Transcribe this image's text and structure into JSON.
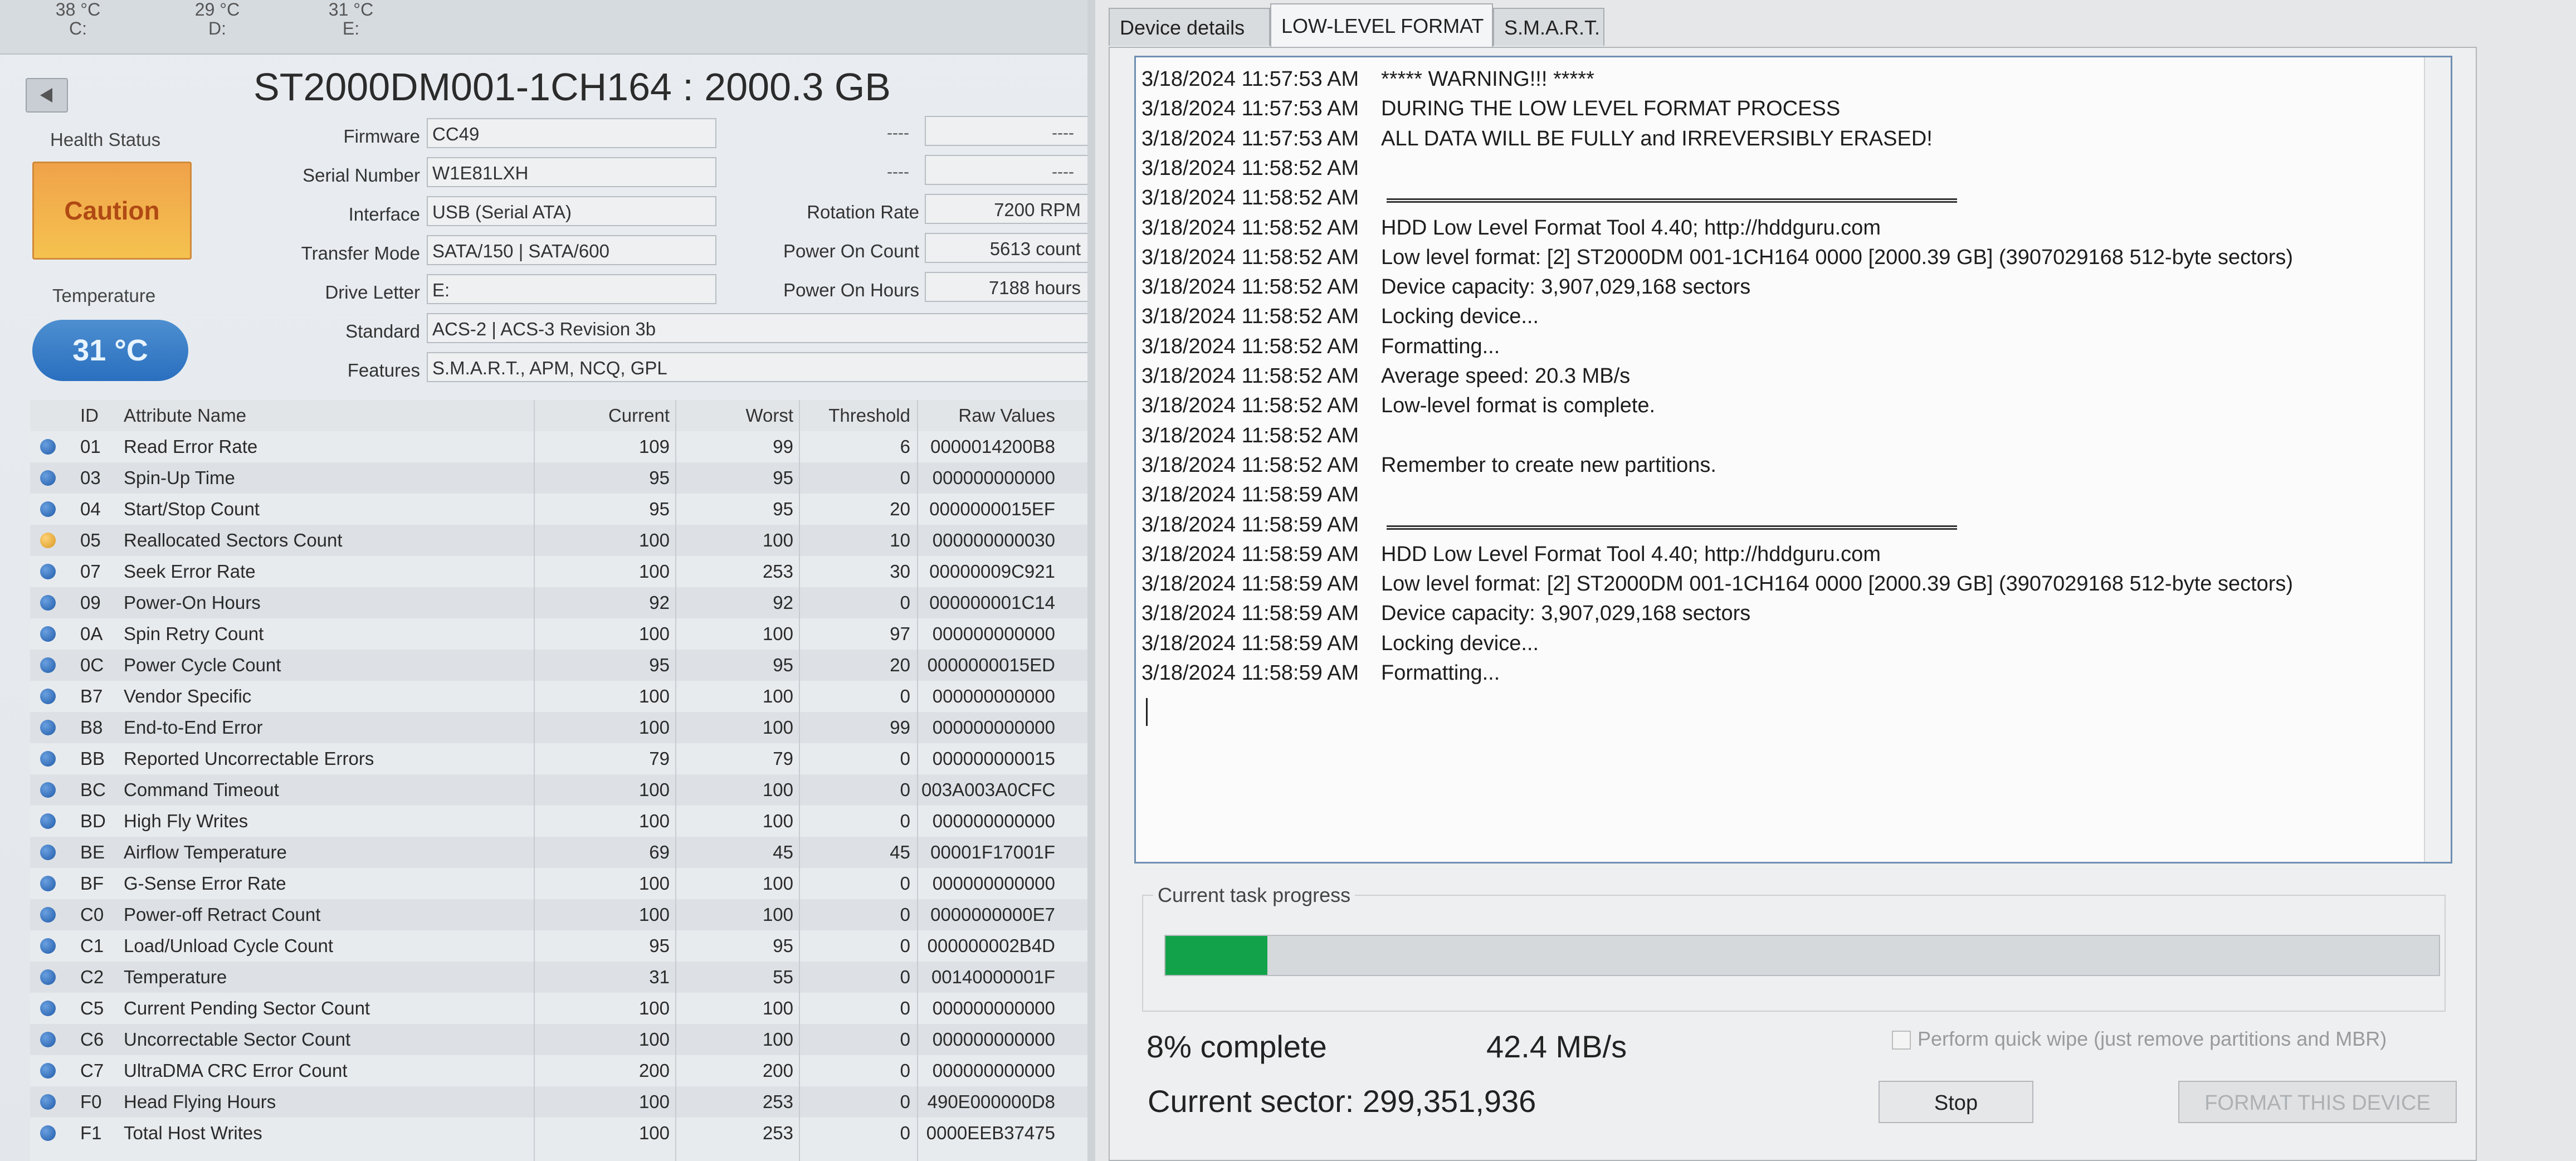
{
  "drive_bar": [
    {
      "temp": "38 °C",
      "letter": "C:"
    },
    {
      "temp": "29 °C",
      "letter": "D:"
    },
    {
      "temp": "31 °C",
      "letter": "E:"
    }
  ],
  "disk": {
    "title": "ST2000DM001-1CH164 : 2000.3 GB",
    "health_label": "Health Status",
    "health_value": "Caution",
    "temperature_label": "Temperature",
    "temperature_value": "31 °C",
    "firmware_label": "Firmware",
    "firmware": "CC49",
    "serial_label": "Serial Number",
    "serial": "W1E81LXH",
    "interface_label": "Interface",
    "interface": "USB (Serial ATA)",
    "transfer_label": "Transfer Mode",
    "transfer": "SATA/150 | SATA/600",
    "letter_label": "Drive Letter",
    "letter": "E:",
    "standard_label": "Standard",
    "standard": "ACS-2 | ACS-3 Revision 3b",
    "features_label": "Features",
    "features": "S.M.A.R.T., APM, NCQ, GPL",
    "dash": "----",
    "rotation_label": "Rotation Rate",
    "rotation": "7200 RPM",
    "power_count_label": "Power On Count",
    "power_count": "5613 count",
    "power_hours_label": "Power On Hours",
    "power_hours": "7188 hours"
  },
  "smart_table": {
    "headers": {
      "id": "ID",
      "name": "Attribute Name",
      "current": "Current",
      "worst": "Worst",
      "threshold": "Threshold",
      "raw": "Raw Values"
    },
    "rows": [
      {
        "id": "01",
        "name": "Read Error Rate",
        "current": "109",
        "worst": "99",
        "threshold": "6",
        "raw": "0000014200B8"
      },
      {
        "id": "03",
        "name": "Spin-Up Time",
        "current": "95",
        "worst": "95",
        "threshold": "0",
        "raw": "000000000000"
      },
      {
        "id": "04",
        "name": "Start/Stop Count",
        "current": "95",
        "worst": "95",
        "threshold": "20",
        "raw": "0000000015EF"
      },
      {
        "id": "05",
        "name": "Reallocated Sectors Count",
        "current": "100",
        "worst": "100",
        "threshold": "10",
        "raw": "000000000030",
        "status": "warning"
      },
      {
        "id": "07",
        "name": "Seek Error Rate",
        "current": "100",
        "worst": "253",
        "threshold": "30",
        "raw": "00000009C921"
      },
      {
        "id": "09",
        "name": "Power-On Hours",
        "current": "92",
        "worst": "92",
        "threshold": "0",
        "raw": "000000001C14"
      },
      {
        "id": "0A",
        "name": "Spin Retry Count",
        "current": "100",
        "worst": "100",
        "threshold": "97",
        "raw": "000000000000"
      },
      {
        "id": "0C",
        "name": "Power Cycle Count",
        "current": "95",
        "worst": "95",
        "threshold": "20",
        "raw": "0000000015ED"
      },
      {
        "id": "B7",
        "name": "Vendor Specific",
        "current": "100",
        "worst": "100",
        "threshold": "0",
        "raw": "000000000000"
      },
      {
        "id": "B8",
        "name": "End-to-End Error",
        "current": "100",
        "worst": "100",
        "threshold": "99",
        "raw": "000000000000"
      },
      {
        "id": "BB",
        "name": "Reported Uncorrectable Errors",
        "current": "79",
        "worst": "79",
        "threshold": "0",
        "raw": "000000000015"
      },
      {
        "id": "BC",
        "name": "Command Timeout",
        "current": "100",
        "worst": "100",
        "threshold": "0",
        "raw": "003A003A0CFC"
      },
      {
        "id": "BD",
        "name": "High Fly Writes",
        "current": "100",
        "worst": "100",
        "threshold": "0",
        "raw": "000000000000"
      },
      {
        "id": "BE",
        "name": "Airflow Temperature",
        "current": "69",
        "worst": "45",
        "threshold": "45",
        "raw": "00001F17001F"
      },
      {
        "id": "BF",
        "name": "G-Sense Error Rate",
        "current": "100",
        "worst": "100",
        "threshold": "0",
        "raw": "000000000000"
      },
      {
        "id": "C0",
        "name": "Power-off Retract Count",
        "current": "100",
        "worst": "100",
        "threshold": "0",
        "raw": "0000000000E7"
      },
      {
        "id": "C1",
        "name": "Load/Unload Cycle Count",
        "current": "95",
        "worst": "95",
        "threshold": "0",
        "raw": "000000002B4D"
      },
      {
        "id": "C2",
        "name": "Temperature",
        "current": "31",
        "worst": "55",
        "threshold": "0",
        "raw": "00140000001F"
      },
      {
        "id": "C5",
        "name": "Current Pending Sector Count",
        "current": "100",
        "worst": "100",
        "threshold": "0",
        "raw": "000000000000"
      },
      {
        "id": "C6",
        "name": "Uncorrectable Sector Count",
        "current": "100",
        "worst": "100",
        "threshold": "0",
        "raw": "000000000000"
      },
      {
        "id": "C7",
        "name": "UltraDMA CRC Error Count",
        "current": "200",
        "worst": "200",
        "threshold": "0",
        "raw": "000000000000"
      },
      {
        "id": "F0",
        "name": "Head Flying Hours",
        "current": "100",
        "worst": "253",
        "threshold": "0",
        "raw": "490E000000D8"
      },
      {
        "id": "F1",
        "name": "Total Host Writes",
        "current": "100",
        "worst": "253",
        "threshold": "0",
        "raw": "0000EEB37475"
      }
    ]
  },
  "tabs": [
    {
      "label": "Device details",
      "active": false
    },
    {
      "label": "LOW-LEVEL FORMAT",
      "active": true
    },
    {
      "label": "S.M.A.R.T.",
      "active": false
    }
  ],
  "log": [
    {
      "time": "3/18/2024 11:57:53 AM",
      "text": "***** WARNING!!! *****"
    },
    {
      "time": "3/18/2024 11:57:53 AM",
      "text": "DURING THE LOW LEVEL FORMAT PROCESS"
    },
    {
      "time": "3/18/2024 11:57:53 AM",
      "text": "ALL DATA WILL BE FULLY and IRREVERSIBLY ERASED!"
    },
    {
      "time": "3/18/2024 11:58:52 AM",
      "text": ""
    },
    {
      "time": "3/18/2024 11:58:52 AM",
      "text": "",
      "rule": true
    },
    {
      "time": "3/18/2024 11:58:52 AM",
      "text": "HDD Low Level Format Tool 4.40; http://hddguru.com"
    },
    {
      "time": "3/18/2024 11:58:52 AM",
      "text": "Low level format: [2]  ST2000DM 001-1CH164   0000   [2000.39 GB]   (3907029168 512-byte sectors)"
    },
    {
      "time": "3/18/2024 11:58:52 AM",
      "text": "Device capacity: 3,907,029,168 sectors"
    },
    {
      "time": "3/18/2024 11:58:52 AM",
      "text": "Locking device..."
    },
    {
      "time": "3/18/2024 11:58:52 AM",
      "text": "Formatting..."
    },
    {
      "time": "3/18/2024 11:58:52 AM",
      "text": "Average speed: 20.3 MB/s"
    },
    {
      "time": "3/18/2024 11:58:52 AM",
      "text": "Low-level format is complete."
    },
    {
      "time": "3/18/2024 11:58:52 AM",
      "text": ""
    },
    {
      "time": "3/18/2024 11:58:52 AM",
      "text": "Remember to create new partitions."
    },
    {
      "time": "3/18/2024 11:58:59 AM",
      "text": ""
    },
    {
      "time": "3/18/2024 11:58:59 AM",
      "text": "",
      "rule": true
    },
    {
      "time": "3/18/2024 11:58:59 AM",
      "text": "HDD Low Level Format Tool 4.40; http://hddguru.com"
    },
    {
      "time": "3/18/2024 11:58:59 AM",
      "text": "Low level format: [2]  ST2000DM 001-1CH164   0000   [2000.39 GB]   (3907029168 512-byte sectors)"
    },
    {
      "time": "3/18/2024 11:58:59 AM",
      "text": "Device capacity: 3,907,029,168 sectors"
    },
    {
      "time": "3/18/2024 11:58:59 AM",
      "text": "Locking device..."
    },
    {
      "time": "3/18/2024 11:58:59 AM",
      "text": "Formatting..."
    }
  ],
  "progress": {
    "title": "Current task progress",
    "fraction": 0.08,
    "percent_text": "8% complete",
    "speed_text": "42.4 MB/s",
    "sector_text": "Current sector: 299,351,936",
    "quick_wipe_label": "Perform quick wipe (just remove partitions and MBR)",
    "stop_label": "Stop",
    "format_label": "FORMAT THIS DEVICE"
  },
  "colors": {
    "progress_fill": "#12a34a",
    "caution": "#f0a24a",
    "temp_badge": "#2a6fbf"
  }
}
